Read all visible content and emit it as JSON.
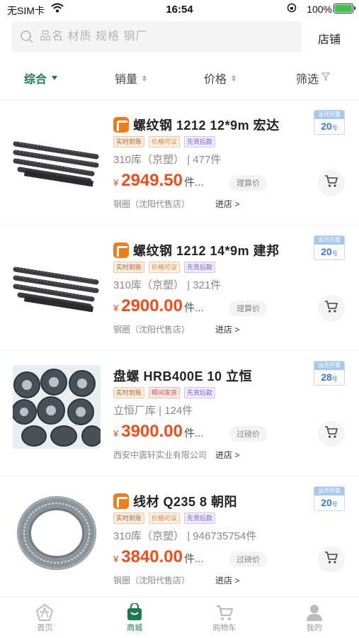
{
  "status_bar": {
    "carrier": "无SIM卡",
    "time": "16:54",
    "battery": "100%"
  },
  "search": {
    "placeholder": "品名 材质 规格 钢厂",
    "shop_label": "店铺"
  },
  "sort": {
    "comprehensive": "综合",
    "sales": "销量",
    "price": "价格",
    "filter": "筛选"
  },
  "products": [
    {
      "title": "螺纹钢 1212 12*9m 宏达",
      "has_logo": true,
      "tags": [
        {
          "text": "实时到账",
          "style": "brown"
        },
        {
          "text": "价格可议",
          "style": "orange"
        },
        {
          "text": "先货后款",
          "style": "purple"
        }
      ],
      "warehouse": "310库（京塑） | 477件",
      "currency": "¥",
      "price": "2949.50",
      "unit": "件...",
      "price_type": "理算价",
      "seller": "钢圈（沈阳代售店）",
      "enter_shop": "进店 >",
      "invoice_top": "当月开票",
      "invoice_day": "20",
      "invoice_suffix": "号",
      "image": "rebar"
    },
    {
      "title": "螺纹钢 1212 14*9m 建邦",
      "has_logo": true,
      "tags": [
        {
          "text": "实时到账",
          "style": "brown"
        },
        {
          "text": "价格可议",
          "style": "orange"
        },
        {
          "text": "先货后款",
          "style": "purple"
        }
      ],
      "warehouse": "310库（京塑） | 321件",
      "currency": "¥",
      "price": "2900.00",
      "unit": "件...",
      "price_type": "理算价",
      "seller": "钢圈（沈阳代售店）",
      "enter_shop": "进店 >",
      "invoice_top": "当月开票",
      "invoice_day": "20",
      "invoice_suffix": "号",
      "image": "rebar"
    },
    {
      "title": "盘螺 HRB400E 10 立恒",
      "has_logo": false,
      "tags": [
        {
          "text": "实时到账",
          "style": "brown"
        },
        {
          "text": "瞬间发货",
          "style": "red"
        },
        {
          "text": "先货后款",
          "style": "purple"
        }
      ],
      "warehouse": "立恒厂库 | 124件",
      "currency": "¥",
      "price": "3900.00",
      "unit": "件...",
      "price_type": "过磅价",
      "seller": "西安中震轩实业有限公司",
      "enter_shop": "进店 >",
      "invoice_top": "当月开票",
      "invoice_day": "28",
      "invoice_suffix": "号",
      "image": "coils"
    },
    {
      "title": "线材 Q235 8 朝阳",
      "has_logo": true,
      "tags": [
        {
          "text": "实时到账",
          "style": "brown"
        },
        {
          "text": "价格可议",
          "style": "orange"
        },
        {
          "text": "先货后款",
          "style": "purple"
        }
      ],
      "warehouse": "310库（京塑） | 946735754件",
      "currency": "¥",
      "price": "3840.00",
      "unit": "件...",
      "price_type": "过磅价",
      "seller": "钢圈（沈阳代售店）",
      "enter_shop": "进店 >",
      "invoice_top": "当月开票",
      "invoice_day": "20",
      "invoice_suffix": "号",
      "image": "wire"
    }
  ],
  "tabbar": [
    {
      "label": "首页",
      "icon": "home-icon",
      "active": false
    },
    {
      "label": "商城",
      "icon": "shop-bag-icon",
      "active": true
    },
    {
      "label": "购物车",
      "icon": "cart-icon",
      "active": false
    },
    {
      "label": "我的",
      "icon": "user-icon",
      "active": false
    }
  ]
}
